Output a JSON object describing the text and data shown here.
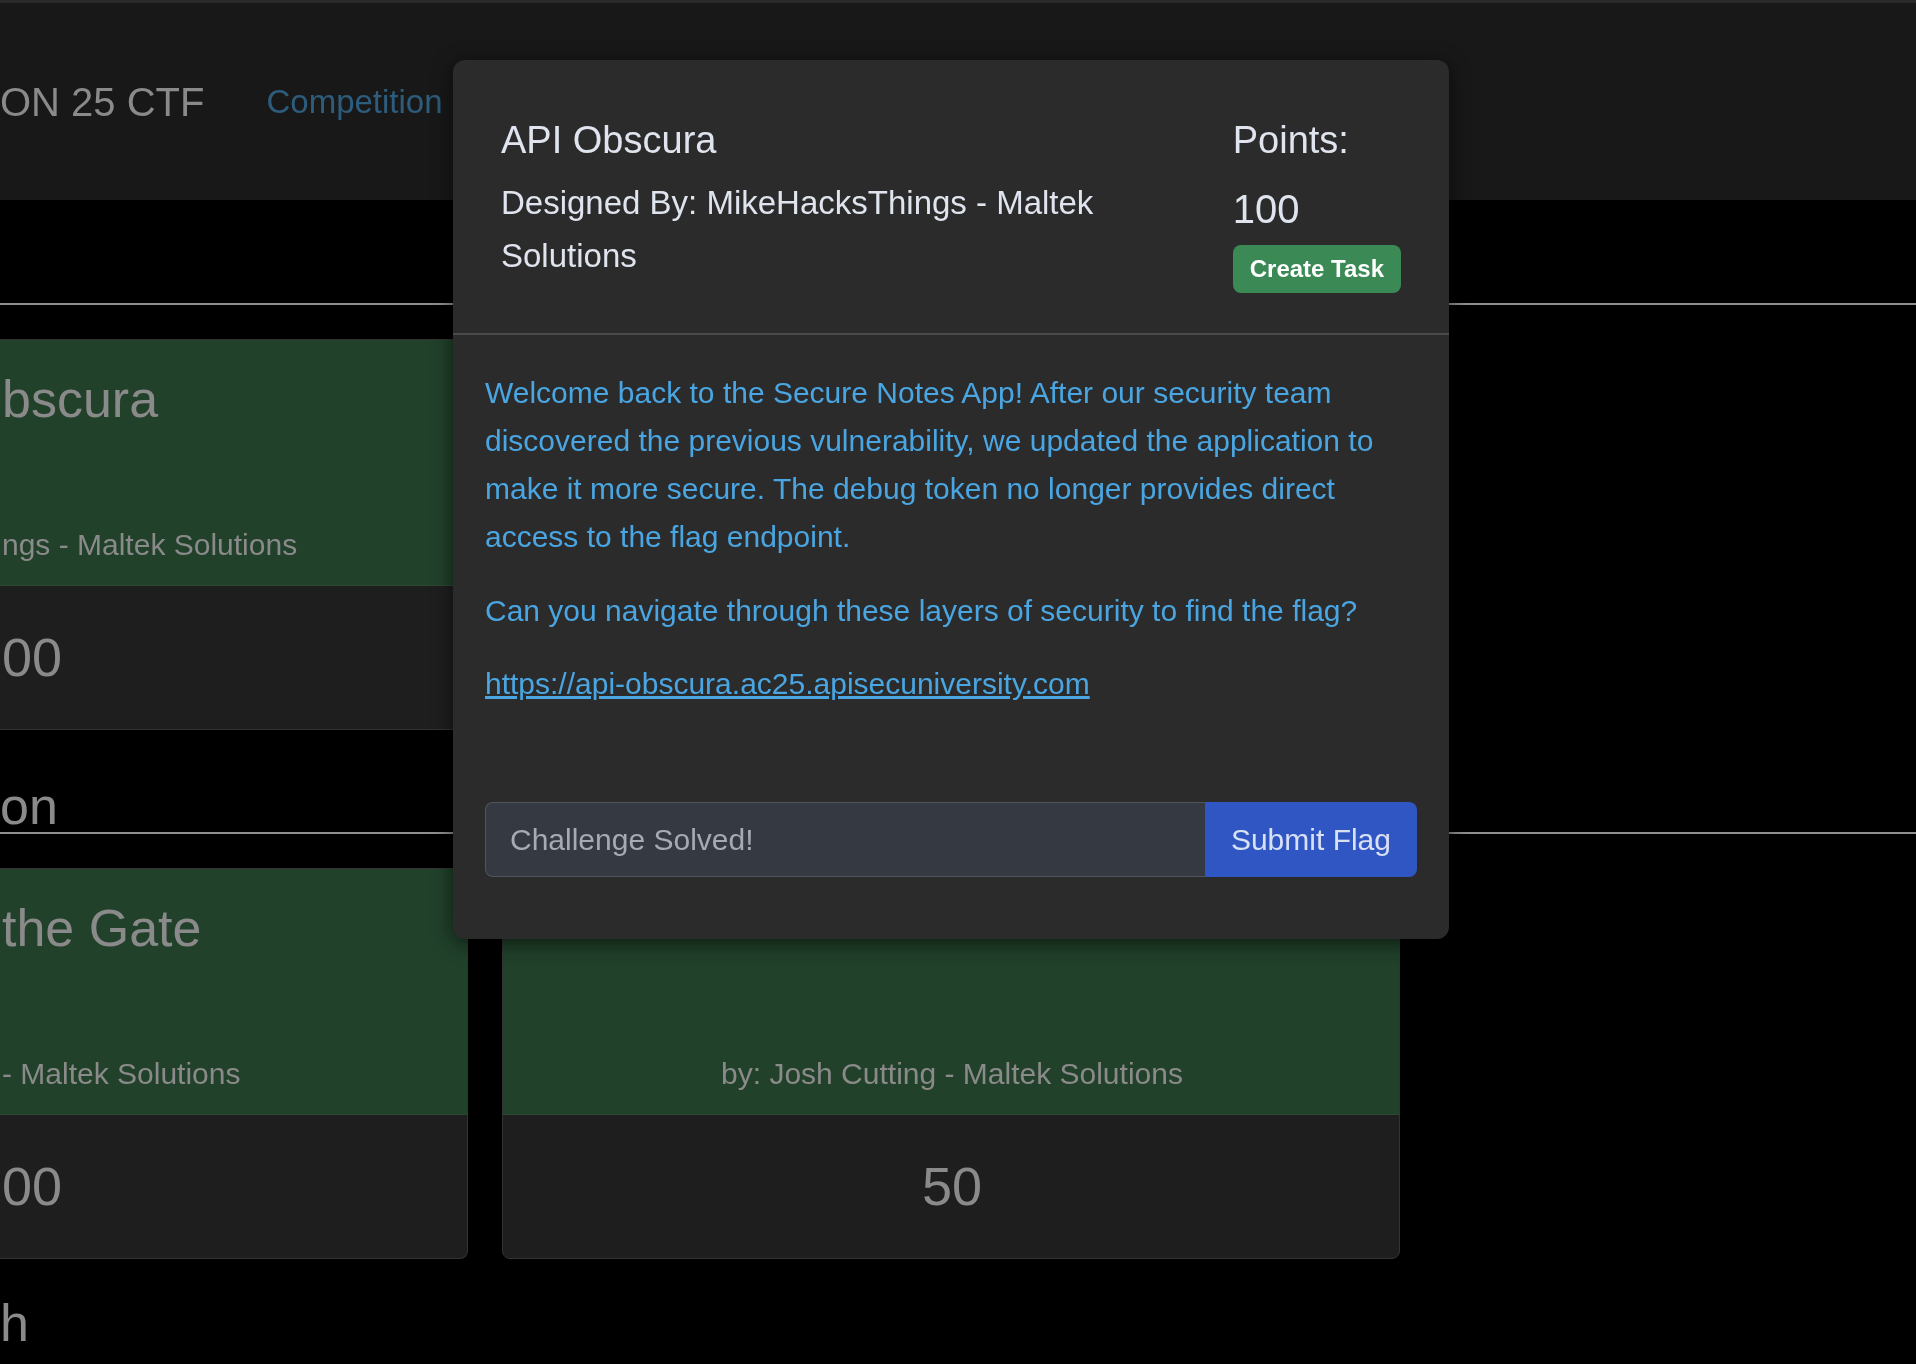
{
  "navbar": {
    "brand": "ON 25 CTF",
    "links": [
      {
        "label": "Competition"
      }
    ]
  },
  "sections": [
    {
      "cards": [
        {
          "title": "bscura",
          "author": "ngs - Maltek Solutions",
          "points": "00",
          "kind": "edge"
        }
      ]
    },
    {
      "heading": "on",
      "cards": [
        {
          "title": "the Gate",
          "author": "- Maltek Solutions",
          "points": "00",
          "kind": "edge"
        },
        {
          "author": "by: Josh Cutting - Maltek Solutions",
          "points": "50",
          "kind": "full"
        }
      ]
    },
    {
      "heading": "h"
    }
  ],
  "modal": {
    "title": "API Obscura",
    "designer": "Designed By: MikeHacksThings - Maltek Solutions",
    "points_label": "Points:",
    "points": "100",
    "action": "Create Task",
    "paragraphs": [
      "Welcome back to the Secure Notes App! After our security team discovered the previous vulnerability, we updated the application to make it more secure. The debug token no longer provides direct access to the flag endpoint.",
      "Can you navigate through these layers of security to find the flag?"
    ],
    "link": "https://api-obscura.ac25.apisecuniversity.com",
    "flag_input": {
      "placeholder": "Challenge Solved!"
    },
    "submit": "Submit Flag"
  }
}
